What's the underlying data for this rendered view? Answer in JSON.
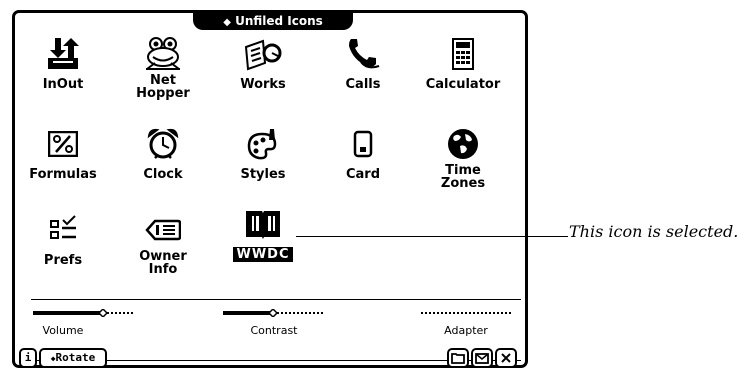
{
  "folder": {
    "title": "Unfiled Icons",
    "marker": "◆"
  },
  "icons": [
    {
      "label": "InOut",
      "icon": "inout-icon"
    },
    {
      "label": "Net\nHopper",
      "icon": "frog-icon"
    },
    {
      "label": "Works",
      "icon": "works-icon"
    },
    {
      "label": "Calls",
      "icon": "phone-icon"
    },
    {
      "label": "Calculator",
      "icon": "calculator-icon"
    },
    {
      "label": "Formulas",
      "icon": "percent-icon"
    },
    {
      "label": "Clock",
      "icon": "alarm-clock-icon"
    },
    {
      "label": "Styles",
      "icon": "palette-icon"
    },
    {
      "label": "Card",
      "icon": "card-icon"
    },
    {
      "label": "Time\nZones",
      "icon": "globe-icon"
    },
    {
      "label": "Prefs",
      "icon": "prefs-icon"
    },
    {
      "label": "Owner\nInfo",
      "icon": "owner-info-icon"
    },
    {
      "label": "WWDC",
      "icon": "book-icon",
      "selected": true
    }
  ],
  "status": {
    "volume": {
      "label": "Volume",
      "level": 0.7
    },
    "contrast": {
      "label": "Contrast",
      "level": 0.5
    },
    "adapter": {
      "label": "Adapter"
    }
  },
  "buttons": {
    "info": "i",
    "rotate": "Rotate",
    "rotate_marker": "◆"
  },
  "callout": "This icon is selected."
}
